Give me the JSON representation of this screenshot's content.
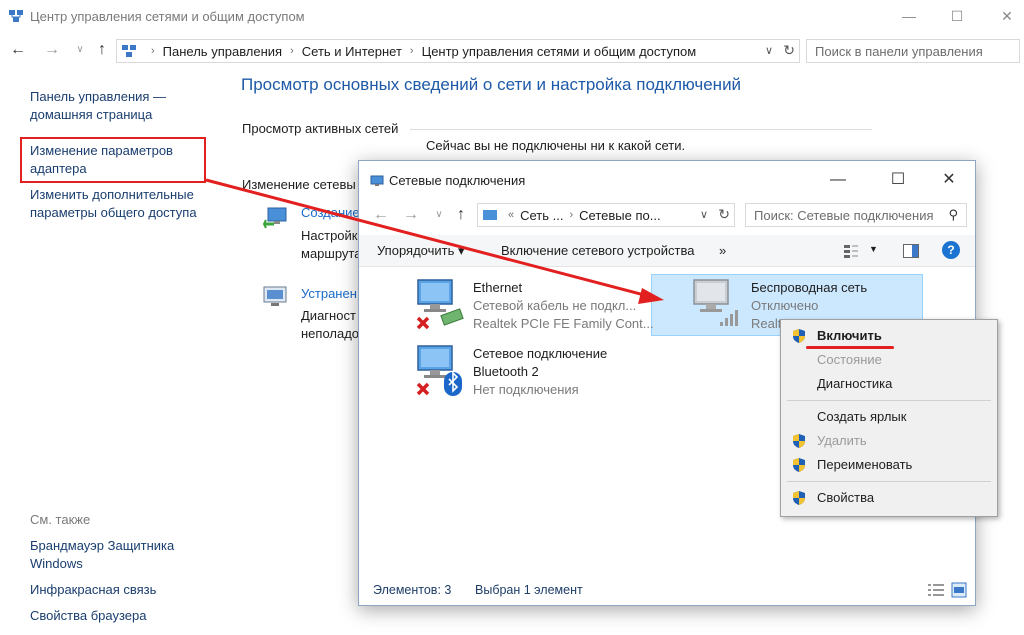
{
  "window": {
    "title": "Центр управления сетями и общим доступом",
    "minimize": "—",
    "maximize": "☐",
    "close": "✕"
  },
  "nav": {
    "back": "←",
    "forward": "→",
    "up": "↑",
    "breadcrumb": [
      "Панель управления",
      "Сеть и Интернет",
      "Центр управления сетями и общим доступом"
    ],
    "search_placeholder": "Поиск в панели управления"
  },
  "sidebar": {
    "home_line1": "Панель управления —",
    "home_line2": "домашняя страница",
    "adapter_line1": "Изменение параметров",
    "adapter_line2": "адаптера",
    "sharing_line1": "Изменить дополнительные",
    "sharing_line2": "параметры общего доступа",
    "see_also": "См. также",
    "firewall_line1": "Брандмауэр Защитника",
    "firewall_line2": "Windows",
    "infrared": "Инфракрасная связь",
    "browser": "Свойства браузера"
  },
  "main": {
    "title": "Просмотр основных сведений о сети и настройка подключений",
    "active_networks": "Просмотр активных сетей",
    "not_connected": "Сейчас вы не подключены ни к какой сети.",
    "change_settings": "Изменение сетевы",
    "create_link": "Создание",
    "create_desc1": "Настройк",
    "create_desc2": "маршрута",
    "troubleshoot_link": "Устранен",
    "troubleshoot_desc1": "Диагност",
    "troubleshoot_desc2": "неполадо"
  },
  "netwin": {
    "title": "Сетевые подключения",
    "breadcrumb": [
      "«",
      "Сеть ...",
      "Сетевые по..."
    ],
    "search_placeholder": "Поиск: Сетевые подключения",
    "organize": "Упорядочить ▾",
    "enable_device": "Включение сетевого устройства",
    "more": "»",
    "help": "?",
    "status_items": "Элементов: 3",
    "status_selected": "Выбран 1 элемент"
  },
  "connections": [
    {
      "name": "Ethernet",
      "line2": "Сетевой кабель не подкл...",
      "line3": "Realtek PCIe FE Family Cont..."
    },
    {
      "name": "Сетевое подключение",
      "line2": "Bluetooth 2",
      "line3": "Нет подключения"
    },
    {
      "name": "Беспроводная сеть",
      "line2": "Отключено",
      "line3": "Realt"
    }
  ],
  "context_menu": {
    "enable": "Включить",
    "status": "Состояние",
    "diagnostics": "Диагностика",
    "create_shortcut": "Создать ярлык",
    "delete": "Удалить",
    "rename": "Переименовать",
    "properties": "Свойства"
  },
  "colors": {
    "accent_red": "#e32020",
    "link_blue": "#1a6cc8",
    "selection": "#cce8ff"
  }
}
